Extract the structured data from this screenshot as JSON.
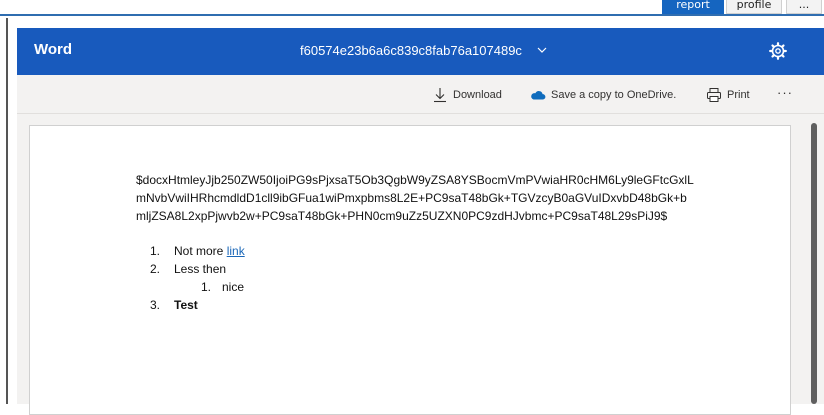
{
  "host": {
    "buttons": [
      "report",
      "profile",
      "..."
    ]
  },
  "titlebar": {
    "app_name": "Word",
    "doc_title": "f60574e23b6a6c839c8fab76a107489c",
    "chevron": "⌵"
  },
  "commands": {
    "download": "Download",
    "save_copy": "Save a copy to OneDrive.",
    "print": "Print",
    "more": "···"
  },
  "document": {
    "encoded_text": "$docxHtmleyJjb250ZW50IjoiPG9sPjxsaT5Ob3QgbW9yZSA8YSBocmVmPVwiaHR0cHM6Ly9leGFtcGxlLmNvbVwiIHRhcmdldD1cll9ibGFua1wiPmxpbms8L2E+PC9saT48bGk+TGVzcyB0aGVuIDxvbD48bGk+bmljZSA8L2xpPjwvb2w+PC9saT48bGk+PHN0cm9uZz5UZXN0PC9zdHJvbmc+PC9saT48L29sPiJ9$",
    "items": [
      {
        "num": "1.",
        "text": "Not more ",
        "link": "link"
      },
      {
        "num": "2.",
        "text": "Less then"
      },
      {
        "num": "1.",
        "text": "nice"
      },
      {
        "num": "3.",
        "text": "Test"
      }
    ]
  },
  "colors": {
    "titlebar": "#185abd",
    "link": "#1a67b8",
    "host_accent": "#1565c0"
  }
}
